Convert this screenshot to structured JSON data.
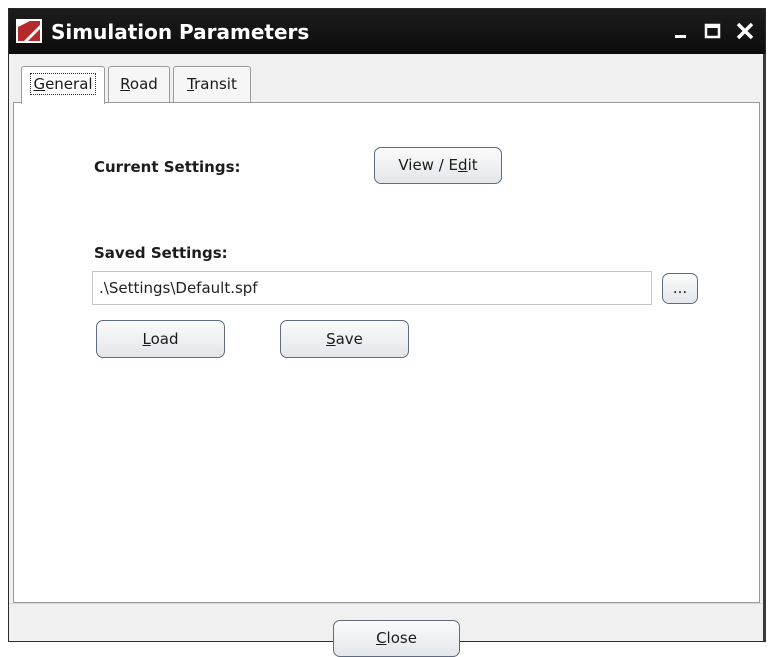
{
  "window": {
    "title": "Simulation Parameters",
    "icon": "app-logo-icon",
    "controls": [
      "minimize-icon",
      "maximize-icon",
      "close-icon"
    ]
  },
  "tabs": [
    {
      "label": "General",
      "underline_char": "G",
      "rest": "eneral",
      "selected": true
    },
    {
      "label": "Road",
      "underline_char": "R",
      "rest": "oad",
      "selected": false
    },
    {
      "label": "Transit",
      "underline_char": "T",
      "rest": "ransit",
      "selected": false
    }
  ],
  "general": {
    "current_settings_label": "Current Settings:",
    "view_edit_button": {
      "before": "View / E",
      "underline": "d",
      "after": "it"
    },
    "saved_settings_label": "Saved Settings:",
    "settings_path": ".\\Settings\\Default.spf",
    "browse_button": "...",
    "load_button": {
      "underline": "L",
      "rest": "oad"
    },
    "save_button": {
      "underline": "S",
      "rest": "ave"
    }
  },
  "footer": {
    "close_button": {
      "underline": "C",
      "rest": "lose"
    }
  },
  "colors": {
    "titlebar": "#111111",
    "logo_red": "#b52a2a",
    "button_border": "#5e6c7d"
  }
}
